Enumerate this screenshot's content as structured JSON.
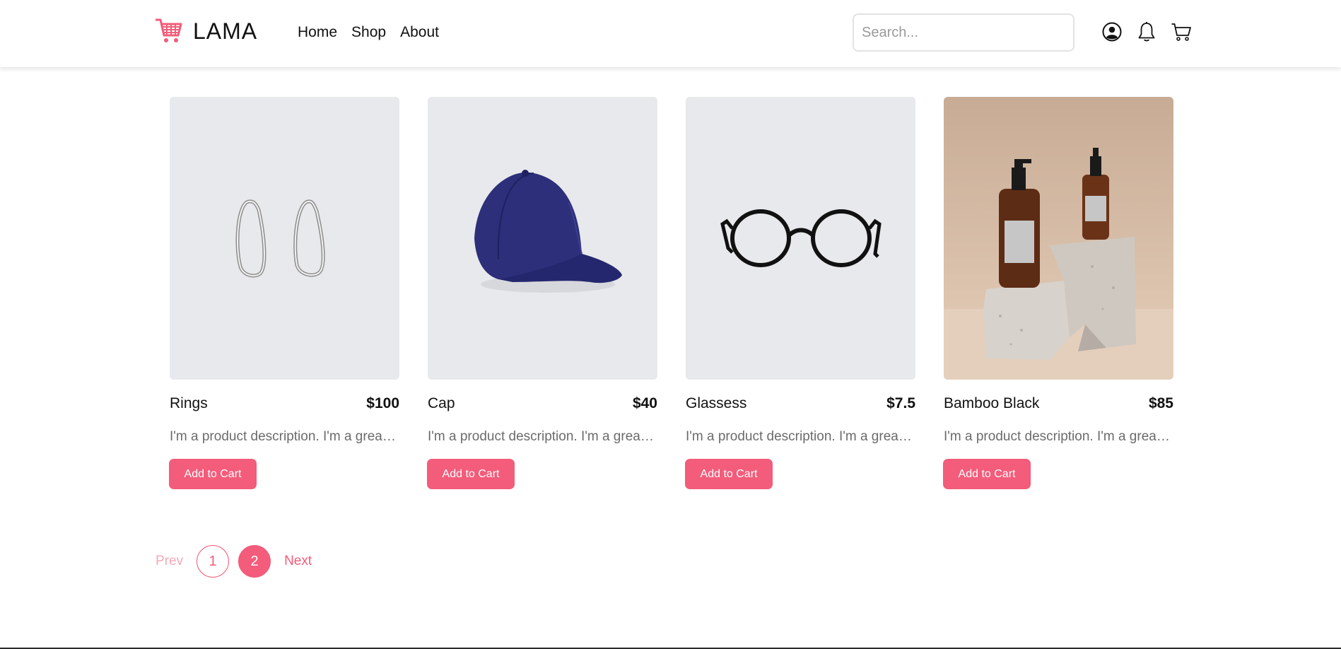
{
  "brand": {
    "name": "LAMA",
    "color": "#f35c7a",
    "icon": "shopping-cart-icon"
  },
  "nav": {
    "links": [
      {
        "label": "Home"
      },
      {
        "label": "Shop"
      },
      {
        "label": "About"
      }
    ]
  },
  "search": {
    "placeholder": "Search...",
    "value": ""
  },
  "header_icons": [
    "profile-icon",
    "bell-icon",
    "cart-icon"
  ],
  "products": [
    {
      "name": "Rings",
      "price": "$100",
      "description": "I'm a product description. I'm a great place to add more details about your product.",
      "button": "Add to Cart",
      "image": "silver-rings"
    },
    {
      "name": "Cap",
      "price": "$40",
      "description": "I'm a product description. I'm a great place to add more details about your product.",
      "button": "Add to Cart",
      "image": "navy-cap"
    },
    {
      "name": "Glassess",
      "price": "$7.5",
      "description": "I'm a product description. I'm a great place to add more details about your product.",
      "button": "Add to Cart",
      "image": "black-glasses"
    },
    {
      "name": "Bamboo Black",
      "price": "$85",
      "description": "I'm a product description. I'm a great place to add more details about your product.",
      "button": "Add to Cart",
      "image": "amber-bottles"
    }
  ],
  "pagination": {
    "prev": "Prev",
    "pages": [
      "1",
      "2"
    ],
    "current": "2",
    "next": "Next"
  }
}
